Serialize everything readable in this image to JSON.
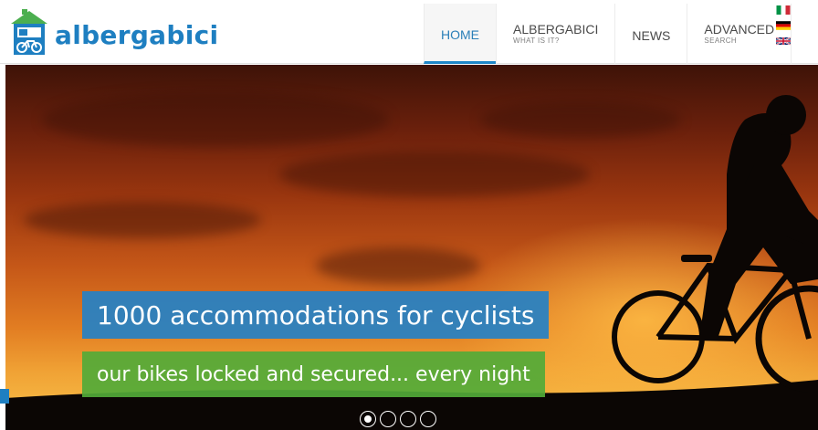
{
  "brand": {
    "name": "albergabici",
    "logo_icon": "hotel-bike-icon",
    "color": "#1e7fc1"
  },
  "nav": {
    "items": [
      {
        "label": "HOME",
        "sublabel": "",
        "active": true
      },
      {
        "label": "ALBERGABICI",
        "sublabel": "WHAT IS IT?",
        "active": false
      },
      {
        "label": "NEWS",
        "sublabel": "",
        "active": false
      },
      {
        "label": "ADVANCED",
        "sublabel": "SEARCH",
        "active": false
      }
    ]
  },
  "languages": [
    {
      "code": "it",
      "icon": "italy-flag-icon"
    },
    {
      "code": "de",
      "icon": "germany-flag-icon"
    },
    {
      "code": "en",
      "icon": "uk-flag-icon"
    }
  ],
  "hero": {
    "caption_1": "1000 accommodations for cyclists",
    "caption_2": "our bikes locked and secured... every night",
    "caption_1_color": "#2581c5",
    "caption_2_color": "#52aa38",
    "slides_count": 4,
    "active_slide": 1
  }
}
